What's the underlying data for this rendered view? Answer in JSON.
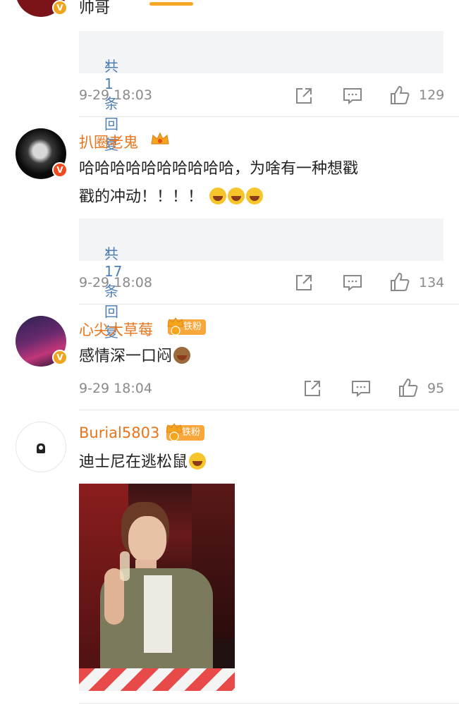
{
  "comments": [
    {
      "text": "帅哥",
      "reply_label": "共1条回复",
      "time": "9-29 18:03",
      "likes": "129"
    },
    {
      "username": "扒圈老鬼",
      "text_line1": "哈哈哈哈哈哈哈哈哈哈，为啥有一种想戳",
      "text_line2": "戳的冲动！！！！",
      "reply_label": "共17条回复",
      "time": "9-29 18:08",
      "likes": "134"
    },
    {
      "username": "心尖大草莓",
      "badge": "铁粉",
      "text": "感情深一口闷",
      "time": "9-29 18:04",
      "likes": "95"
    },
    {
      "username": "Burial5803",
      "badge": "铁粉",
      "text": "迪士尼在逃松鼠"
    }
  ],
  "colors": {
    "accent": "#f6a623",
    "username": "#e8741c",
    "link": "#4e7fb5",
    "meta": "#8a8a8a"
  },
  "icons": [
    "share-icon",
    "comment-icon",
    "like-icon",
    "crown-icon",
    "verified-icon",
    "chevron-right-icon"
  ]
}
